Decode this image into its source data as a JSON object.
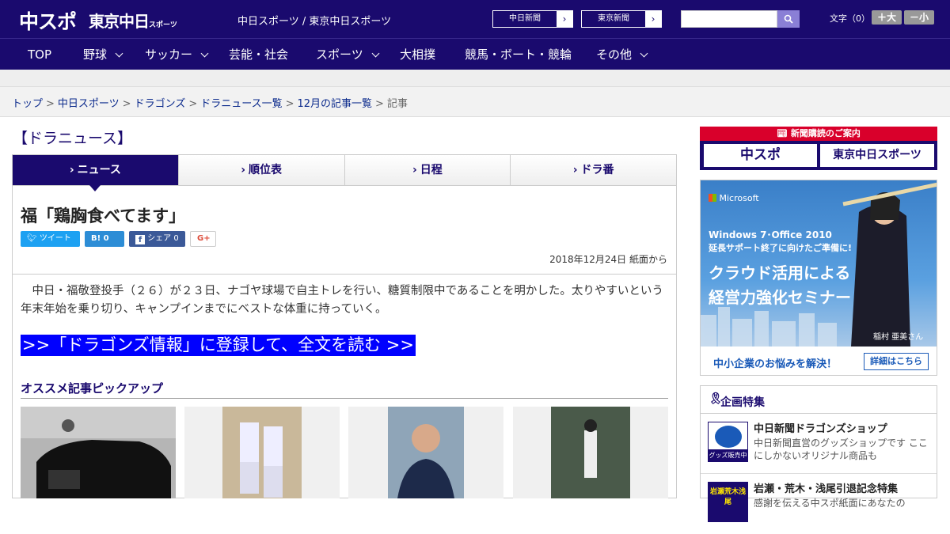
{
  "header": {
    "logo_chuspo": "中スポ",
    "logo_tokyo": "東京中日",
    "logo_tokyo_sub": "スポーツ",
    "site_links": "中日スポーツ / 東京中日スポーツ",
    "chunichi_label": "中日新聞",
    "tokyo_label": "東京新聞",
    "fontsize_label": "文字（0）",
    "bigger_label": "＋大",
    "smaller_label": "－小"
  },
  "nav": {
    "items": [
      {
        "label": "TOP"
      },
      {
        "label": "野球"
      },
      {
        "label": "サッカー"
      },
      {
        "label": "芸能・社会"
      },
      {
        "label": "スポーツ"
      },
      {
        "label": "大相撲"
      },
      {
        "label": "競馬・ボート・競輪"
      },
      {
        "label": "その他"
      }
    ]
  },
  "breadcrumb": {
    "items": [
      "トップ",
      "中日スポーツ",
      "ドラゴンズ",
      "ドラニュース一覧",
      "12月の記事一覧"
    ],
    "current": "記事",
    "separator": ">"
  },
  "section_title": "【ドラニュース】",
  "tabs": [
    {
      "label": "ニュース"
    },
    {
      "label": "順位表"
    },
    {
      "label": "日程"
    },
    {
      "label": "ドラ番"
    }
  ],
  "article": {
    "headline": "福「鶏胸食べてます」",
    "share": {
      "tweet": "ツイート",
      "hatena": "B! 0",
      "facebook": "シェア 0",
      "gplus": "G+"
    },
    "dateline": "2018年12月24日 紙面から",
    "body": "中日・福敬登投手（２６）が２３日、ナゴヤ球場で自主トレを行い、糖質制限中であることを明かした。太りやすいという年末年始を乗り切り、キャンプインまでにベストな体重に持っていく。",
    "read_more": ">>「ドラゴンズ情報」に登録して、全文を読む >>"
  },
  "pickup": {
    "title": "オススメ記事ピックアップ"
  },
  "sidebar": {
    "subscribe_title": "新聞購読のご案内",
    "sub_logo_1": "中スポ",
    "sub_logo_2": "東京中日スポーツ",
    "ad": {
      "brand": "Microsoft",
      "line1": "Windows 7･Office 2010",
      "line2": "延長サポート終了に向けたご準備に!",
      "headline1": "クラウド活用による",
      "headline2": "経営力強化セミナー",
      "person": "稲村 亜美さん",
      "bottom_text": "中小企業のお悩みを解決！",
      "bottom_button": "詳細はこちら"
    },
    "feature": {
      "title": "企画特集",
      "items": [
        {
          "title": "中日新聞ドラゴンズショップ",
          "desc": "中日新聞直営のグッズショップです ここにしかないオリジナル商品も",
          "thumb_text": "グッズ販売中"
        },
        {
          "title": "岩瀬・荒木・浅尾引退記念特集",
          "desc": "感謝を伝える中スポ紙面にあなたの",
          "thumb_text": "岩瀬荒木浅尾"
        }
      ]
    }
  }
}
